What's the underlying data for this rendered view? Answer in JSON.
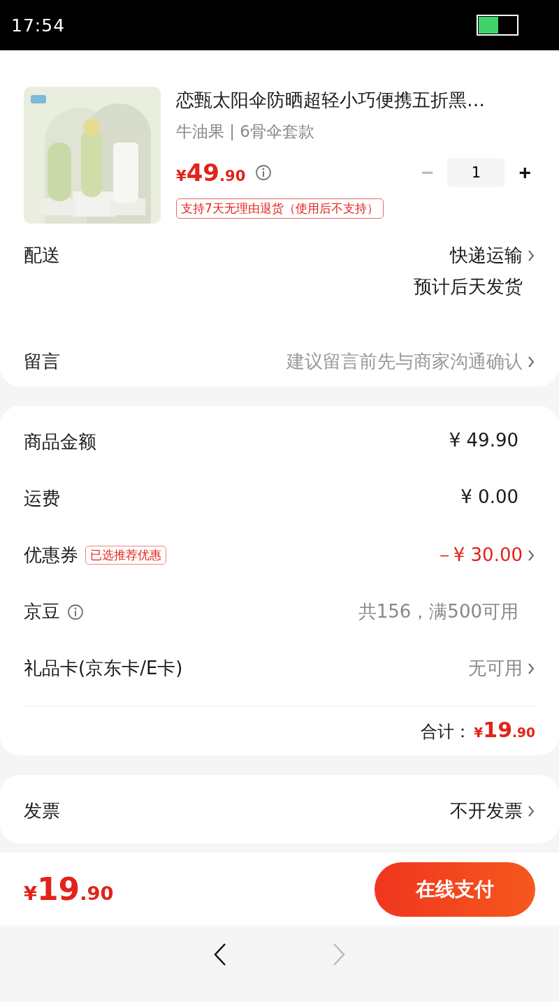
{
  "status_bar": {
    "time": "17:54"
  },
  "product": {
    "title": "恋甄太阳伞防晒超轻小巧便携五折黑…",
    "variant": "牛油果 | 6骨伞套款",
    "price_symbol": "¥",
    "price_int": "49",
    "price_dec": ".90",
    "quantity": "1",
    "minus": "−",
    "plus": "+",
    "minus_disabled": true,
    "return_tag": "支持7天无理由退货（使用后不支持）"
  },
  "order_rows": [
    {
      "label": "配送",
      "value": "快递运输",
      "sub": "预计后天发货",
      "muted": false,
      "arrow": true
    },
    {
      "label": "留言",
      "value": "建议留言前先与商家沟通确认",
      "muted": true,
      "arrow": true
    }
  ],
  "summary_rows": [
    {
      "label": "商品金额",
      "value": "¥ 49.90",
      "kind": "plain",
      "arrow": false
    },
    {
      "label": "运费",
      "value": "¥ 0.00",
      "kind": "plain",
      "arrow": false
    },
    {
      "label": "优惠券",
      "tag": "已选推荐优惠",
      "value": "－¥ 30.00",
      "kind": "discount",
      "arrow": true
    },
    {
      "label": "京豆",
      "info": true,
      "value": "共156，满500可用",
      "kind": "muted",
      "arrow": false
    },
    {
      "label": "礼品卡(京东卡/E卡)",
      "value": "无可用",
      "kind": "muted",
      "arrow": true
    }
  ],
  "total": {
    "label": "合计：",
    "symbol": "¥",
    "int": "19",
    "dec": ".90"
  },
  "invoice": {
    "label": "发票",
    "value": "不开发票"
  },
  "footer": {
    "symbol": "¥",
    "int": "19",
    "dec": ".90",
    "pay_button": "在线支付"
  },
  "nav": {
    "back_disabled": false,
    "forward_disabled": true
  }
}
